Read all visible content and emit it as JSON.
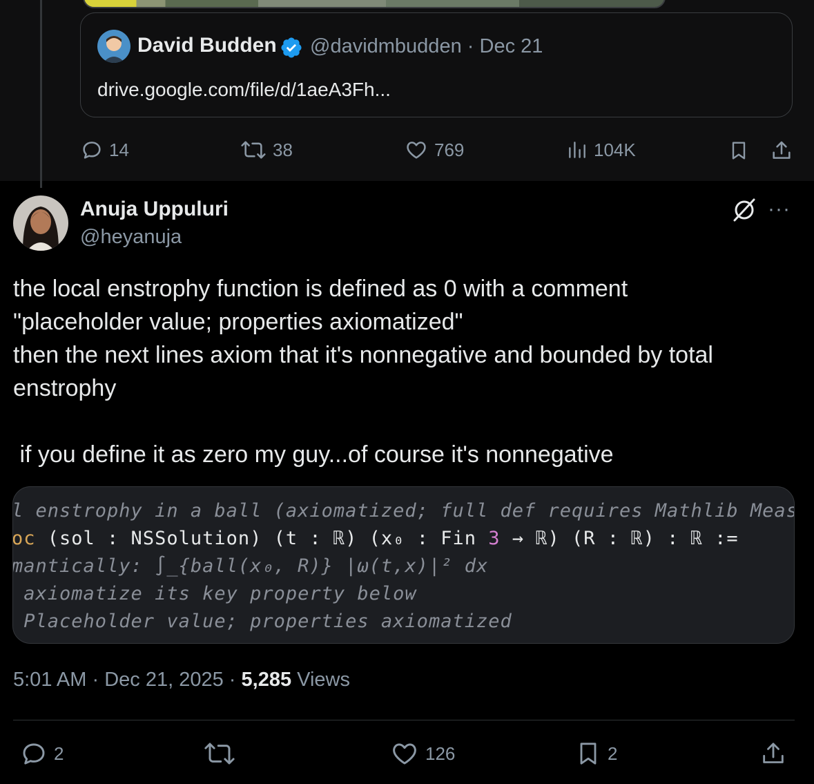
{
  "quoted": {
    "author_name": "David Budden",
    "author_handle": "@davidmbudden",
    "date": "Dec 21",
    "meta_sep": "·",
    "text": "drive.google.com/file/d/1aeA3Fh...",
    "verified_icon": "verified-badge-icon"
  },
  "parent_actions": {
    "replies": "14",
    "reposts": "38",
    "likes": "769",
    "views": "104K"
  },
  "post": {
    "author_name": "Anuja Uppuluri",
    "author_handle": "@heyanuja",
    "paragraph1": "the local enstrophy function is  defined as 0 with a comment\n\"placeholder value; properties axiomatized\"\nthen the next lines axiom that it's nonnegative and bounded by total\nenstrophy",
    "paragraph2": " if you define it as zero my guy...of course it's nonnegative",
    "more_icon": "···"
  },
  "code": {
    "line1": "l enstrophy in a ball (axiomatized; full def requires Mathlib MeasureTh",
    "line2_kw": "oc",
    "line2_rest_a": " (sol : NSSolution) (t : ℝ) (x₀ : Fin ",
    "line2_num": "3",
    "line2_rest_b": " → ℝ) (R : ℝ) : ℝ :=",
    "line3": "mantically: ∫_{ball(x₀, R)} |ω(t,x)|² dx",
    "line4": " axiomatize its key property below",
    "line5": " Placeholder value; properties axiomatized"
  },
  "meta": {
    "time": "5:01 AM",
    "date": "Dec 21, 2025",
    "sep": "·",
    "views_count": "5,285",
    "views_label": "Views"
  },
  "post_actions": {
    "replies": "2",
    "likes": "126",
    "bookmarks": "2"
  },
  "colors": {
    "background": "#000000",
    "text": "#e7e9ea",
    "muted": "#8b98a5",
    "verified": "#1d9bf0"
  }
}
